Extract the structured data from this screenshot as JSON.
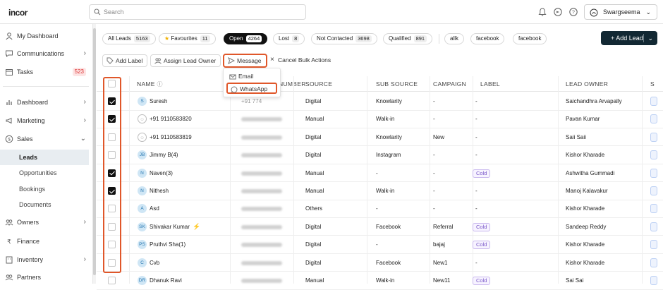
{
  "app": {
    "logo": "incor"
  },
  "topbar": {
    "search_placeholder": "Search",
    "user_name": "Swargseema"
  },
  "sidebar": {
    "items": [
      {
        "label": "My Dashboard",
        "icon": "user-icon"
      },
      {
        "label": "Communications",
        "icon": "chat-icon",
        "has_arrow": true
      },
      {
        "label": "Tasks",
        "icon": "calendar-icon",
        "badge": "523"
      },
      {
        "label": "Dashboard",
        "icon": "bar-chart-icon",
        "has_arrow": true
      },
      {
        "label": "Marketing",
        "icon": "megaphone-icon",
        "has_arrow": true
      },
      {
        "label": "Sales",
        "icon": "dollar-icon",
        "expanded": true
      },
      {
        "label": "Owners",
        "icon": "people-icon",
        "has_arrow": true
      },
      {
        "label": "Finance",
        "icon": "rupee-icon"
      },
      {
        "label": "Inventory",
        "icon": "building-icon",
        "has_arrow": true
      },
      {
        "label": "Partners",
        "icon": "partners-icon"
      }
    ],
    "sales_sub": [
      "Leads",
      "Opportunities",
      "Bookings",
      "Documents"
    ],
    "active_sub": "Leads"
  },
  "filters": [
    {
      "label": "All Leads",
      "count": "5163"
    },
    {
      "label": "Favourites",
      "count": "11",
      "star": true
    },
    {
      "label": "Open",
      "count": "4264",
      "active": true
    },
    {
      "label": "Lost",
      "count": "8"
    },
    {
      "label": "Not Contacted",
      "count": "3698"
    },
    {
      "label": "Qualified",
      "count": "891"
    },
    {
      "label": "allk"
    },
    {
      "label": "facebook"
    },
    {
      "label": "facebook"
    }
  ],
  "add_lead_label": "+ Add Lead",
  "bulk_actions": {
    "add_label": "Add Label",
    "assign_owner": "Assign Lead Owner",
    "message": "Message",
    "cancel": "Cancel Bulk Actions"
  },
  "message_menu": [
    "Email",
    "WhatsApp"
  ],
  "columns": [
    "NAME",
    "NUMBER",
    "SOURCE",
    "SUB SOURCE",
    "CAMPAIGN",
    "LABEL",
    "LEAD OWNER",
    "S"
  ],
  "rows": [
    {
      "initials": "S",
      "name": "Suresh",
      "checked": true,
      "number_prefix": "+91 774",
      "source": "Digital",
      "sub_source": "Knowlarity",
      "campaign": "-",
      "label": "-",
      "owner": "Saichandhra Arvapally"
    },
    {
      "initials": "",
      "name": "+91 9110583820",
      "checked": true,
      "source": "Manual",
      "sub_source": "Walk-in",
      "campaign": "-",
      "label": "-",
      "owner": "Pavan Kumar"
    },
    {
      "initials": "",
      "name": "+91 9110583819",
      "checked": false,
      "source": "Digital",
      "sub_source": "Knowlarity",
      "campaign": "New",
      "label": "-",
      "owner": "Saii Saii"
    },
    {
      "initials": "JB",
      "name": "Jimmy B(4)",
      "checked": false,
      "source": "Digital",
      "sub_source": "Instagram",
      "campaign": "-",
      "label": "-",
      "owner": "Kishor Kharade"
    },
    {
      "initials": "N",
      "name": "Naven(3)",
      "checked": true,
      "source": "Manual",
      "sub_source": "-",
      "campaign": "-",
      "label": "Cold",
      "owner": "Ashwitha Gummadi"
    },
    {
      "initials": "N",
      "name": "Nithesh",
      "checked": true,
      "source": "Manual",
      "sub_source": "Walk-in",
      "campaign": "-",
      "label": "-",
      "owner": "Manoj Kalavakur"
    },
    {
      "initials": "A",
      "name": "Asd",
      "checked": false,
      "source": "Others",
      "sub_source": "-",
      "campaign": "-",
      "label": "-",
      "owner": "Kishor Kharade"
    },
    {
      "initials": "SK",
      "name": "Shivakar Kumar",
      "checked": false,
      "lightning": true,
      "source": "Digital",
      "sub_source": "Facebook",
      "campaign": "Referral",
      "label": "Cold",
      "owner": "Sandeep Reddy"
    },
    {
      "initials": "PS",
      "name": "Pruthvi Sha(1)",
      "checked": false,
      "source": "Digital",
      "sub_source": "-",
      "campaign": "bajaj",
      "label": "Cold",
      "owner": "Kishor Kharade"
    },
    {
      "initials": "C",
      "name": "Cvb",
      "checked": false,
      "source": "Digital",
      "sub_source": "Facebook",
      "campaign": "New1",
      "label": "-",
      "owner": "Kishor Kharade"
    },
    {
      "initials": "DR",
      "name": "Dhanuk Ravi",
      "checked": false,
      "source": "Manual",
      "sub_source": "Walk-in",
      "campaign": "New11",
      "label": "Cold",
      "owner": "Sai Sai"
    }
  ],
  "colors": {
    "accent_dark": "#122833",
    "highlight": "#e0572a",
    "cold_tag": "#7a58c9",
    "badge_red": "#d33"
  }
}
